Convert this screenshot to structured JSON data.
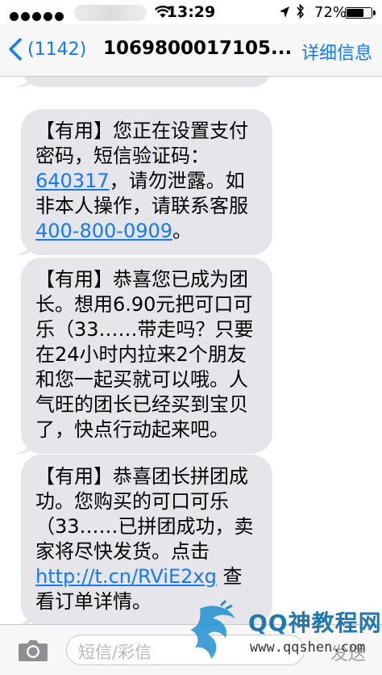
{
  "status_bar": {
    "time": "13:29",
    "battery_percent": "72%",
    "battery_level": 0.72
  },
  "nav": {
    "back_count": "(1142)",
    "title": "1069800017105...",
    "detail_label": "详细信息"
  },
  "messages": [
    {
      "segments": [
        {
          "text": "400-800-0909",
          "link": true
        },
        {
          "text": "。",
          "link": false
        }
      ]
    },
    {
      "segments": [
        {
          "text": "【有用】您正在设置支付密码，短信验证码：",
          "link": false
        },
        {
          "text": "640317",
          "link": true
        },
        {
          "text": "，请勿泄露。如非本人操作，请联系客服",
          "link": false
        },
        {
          "text": "400-800-0909",
          "link": true
        },
        {
          "text": "。",
          "link": false
        }
      ]
    },
    {
      "segments": [
        {
          "text": "【有用】恭喜您已成为团长。想用6.90元把可口可乐（33……带走吗？只要在24小时内拉来2个朋友和您一起买就可以哦。人气旺的团长已经买到宝贝了，快点行动起来吧。",
          "link": false
        }
      ]
    },
    {
      "segments": [
        {
          "text": "【有用】恭喜团长拼团成功。您购买的可口可乐（33……已拼团成功，卖家将尽快发货。点击",
          "link": false
        },
        {
          "text": "http://t.cn/RViE2xg",
          "link": true
        },
        {
          "text": " 查看订单详情。",
          "link": false
        }
      ]
    }
  ],
  "input_bar": {
    "placeholder": "短信/彩信",
    "send_label": "发送"
  },
  "watermark": {
    "title": "QQ神教程网",
    "url": "www.qqshen.com"
  },
  "colors": {
    "accent": "#1479fb",
    "bubble": "#e5e5ea"
  }
}
